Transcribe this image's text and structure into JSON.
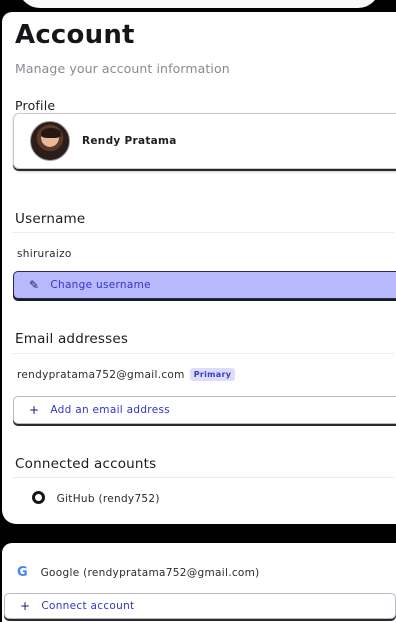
{
  "header": {
    "title": "Account",
    "subtitle": "Manage your account information"
  },
  "profile": {
    "label": "Profile",
    "name": "Rendy Pratama"
  },
  "username": {
    "label": "Username",
    "value": "shiruraizo",
    "change_label": "Change username"
  },
  "email": {
    "label": "Email addresses",
    "address": "rendypratama752@gmail.com",
    "badge": "Primary",
    "add_label": "Add an email address"
  },
  "connected": {
    "label": "Connected accounts",
    "github": "GitHub (rendy752)",
    "google": "Google (rendypratama752@gmail.com)",
    "connect_label": "Connect account"
  },
  "icons": {
    "pencil": "pencil-icon",
    "plus": "plus-icon",
    "github": "github-icon",
    "google": "google-icon"
  },
  "colors": {
    "accent": "#3434c8",
    "accent_bg": "#b8b8fc",
    "badge_bg": "#dcdcfd"
  }
}
